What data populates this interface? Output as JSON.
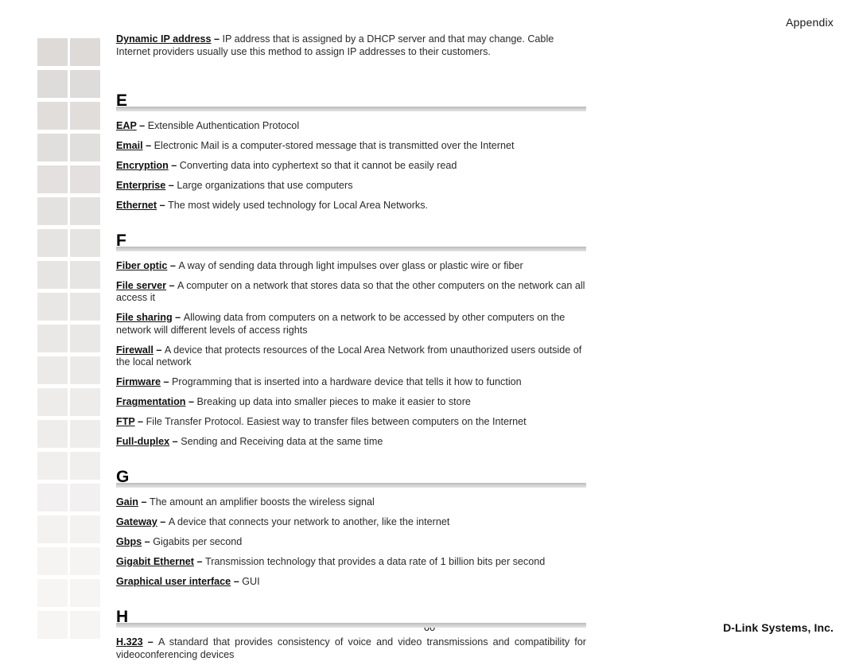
{
  "header": {
    "title": "Appendix"
  },
  "footer": {
    "page_number": "60",
    "company": "D-Link Systems, Inc."
  },
  "artifacts": {
    "name": "scan-artifact-squares",
    "color": "#dddad8",
    "columns": 2,
    "rows": 19
  },
  "intro_entries": [
    {
      "term": "Dynamic IP address",
      "dash": "–",
      "definition": "IP address that is assigned by a DHCP server and that may change.  Cable Internet providers usually use this method to assign IP addresses to their customers."
    }
  ],
  "sections": [
    {
      "letter": "E",
      "entries": [
        {
          "term": "EAP",
          "dash": "–",
          "definition": "Extensible Authentication Protocol"
        },
        {
          "term": "Email",
          "dash": "–",
          "definition": "Electronic Mail is a computer-stored message that is transmitted over the Internet"
        },
        {
          "term": "Encryption",
          "dash": "–",
          "definition": "Converting data into cyphertext so that it cannot be easily read"
        },
        {
          "term": "Enterprise",
          "dash": "–",
          "definition": "Large organizations that use computers"
        },
        {
          "term": "Ethernet",
          "dash": "–",
          "definition": "The most widely used technology for Local Area Networks."
        }
      ]
    },
    {
      "letter": "F",
      "entries": [
        {
          "term": "Fiber optic",
          "dash": "–",
          "definition": "A way of sending data through light impulses over glass or plastic wire or fiber"
        },
        {
          "term": "File server",
          "dash": "–",
          "definition": "A computer on a network that stores data so that the other computers on the network can all access it"
        },
        {
          "term": "File sharing",
          "dash": "–",
          "definition": "Allowing data from computers on a network to be accessed by other computers on the network will different levels of access rights"
        },
        {
          "term": "Firewall",
          "dash": "–",
          "definition": "A device that protects resources of the Local Area Network from unauthorized users outside of the local network"
        },
        {
          "term": "Firmware",
          "dash": "–",
          "definition": "Programming that is inserted into a hardware device that tells it how to function"
        },
        {
          "term": "Fragmentation",
          "dash": "–",
          "definition": "Breaking up data into smaller pieces to make it easier to store"
        },
        {
          "term": "FTP",
          "dash": "–",
          "definition": "File Transfer Protocol.  Easiest way to transfer files between computers on the Internet"
        },
        {
          "term": "Full-duplex",
          "dash": "–",
          "definition": "Sending and Receiving data at the same time"
        }
      ]
    },
    {
      "letter": "G",
      "entries": [
        {
          "term": "Gain",
          "dash": "–",
          "definition": "The amount an amplifier boosts the wireless signal"
        },
        {
          "term": "Gateway",
          "dash": "–",
          "definition": "A device that connects your network to another, like the internet"
        },
        {
          "term": "Gbps",
          "dash": "–",
          "definition": "Gigabits per second"
        },
        {
          "term": "Gigabit Ethernet",
          "dash": "–",
          "definition": "Transmission technology that provides a data rate of 1 billion bits per second"
        },
        {
          "term": "Graphical user interface",
          "dash": "–",
          "definition": "GUI"
        }
      ]
    },
    {
      "letter": "H",
      "entries": [
        {
          "term": "H.323",
          "dash": "–",
          "definition": "A standard that provides consistency of voice and video transmissions and compatibility for videoconferencing devices",
          "justified": true
        }
      ]
    }
  ]
}
